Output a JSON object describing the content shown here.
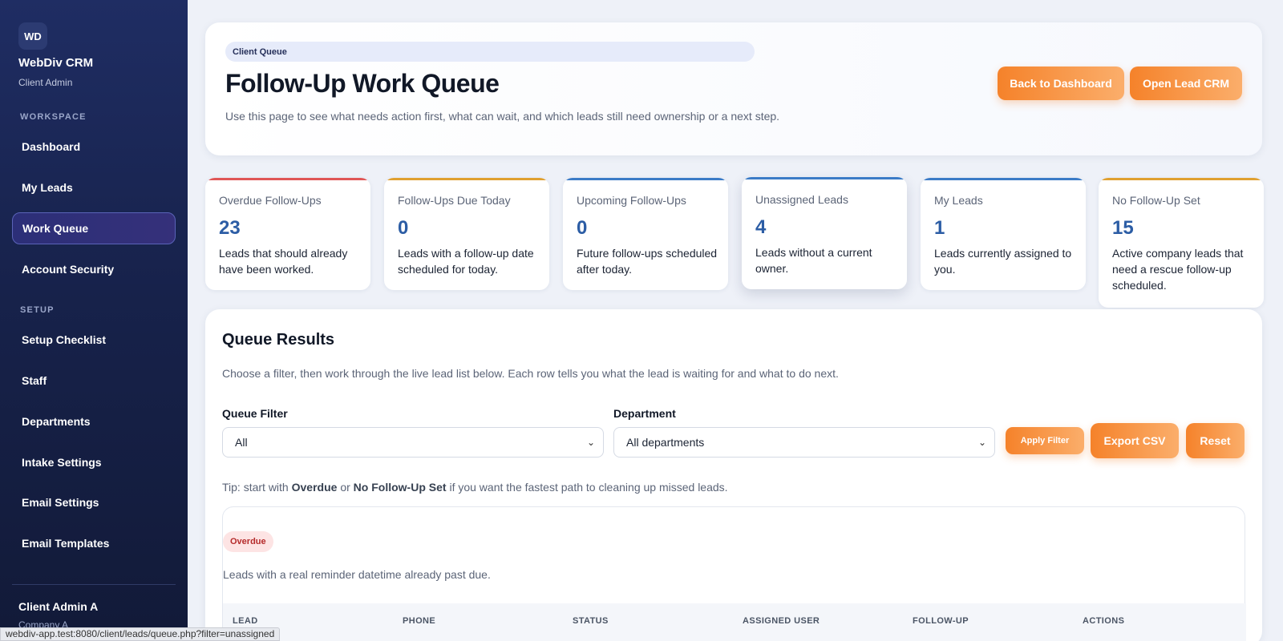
{
  "sidebar": {
    "badge": "WD",
    "brand": "WebDiv CRM",
    "role": "Client Admin",
    "sections": [
      "WORKSPACE",
      "SETUP"
    ],
    "workspace_items": [
      "Dashboard",
      "My Leads",
      "Work Queue",
      "Account Security"
    ],
    "setup_items": [
      "Setup Checklist",
      "Staff",
      "Departments",
      "Intake Settings",
      "Email Settings",
      "Email Templates"
    ],
    "user_name": "Client Admin A",
    "user_company": "Company A"
  },
  "status_url": "webdiv-app.test:8080/client/leads/queue.php?filter=unassigned",
  "hero": {
    "pill": "Client Queue",
    "title": "Follow-Up Work Queue",
    "description": "Use this page to see what needs action first, what can wait, and which leads still need ownership or a next step.",
    "back_button": "Back to Dashboard",
    "open_button": "Open Lead CRM"
  },
  "stats": [
    {
      "label": "Overdue Follow-Ups",
      "value": "23",
      "desc": "Leads that should already have been worked.",
      "color": "#e05656"
    },
    {
      "label": "Follow-Ups Due Today",
      "value": "0",
      "desc": "Leads with a follow-up date scheduled for today.",
      "color": "#e0a030"
    },
    {
      "label": "Upcoming Follow-Ups",
      "value": "0",
      "desc": "Future follow-ups scheduled after today.",
      "color": "#3b7bc7"
    },
    {
      "label": "Unassigned Leads",
      "value": "4",
      "desc": "Leads without a current owner.",
      "color": "#3b7bc7"
    },
    {
      "label": "My Leads",
      "value": "1",
      "desc": "Leads currently assigned to you.",
      "color": "#3b7bc7"
    },
    {
      "label": "No Follow-Up Set",
      "value": "15",
      "desc": "Active company leads that need a rescue follow-up scheduled.",
      "color": "#e0a030"
    }
  ],
  "results": {
    "title": "Queue Results",
    "description": "Choose a filter, then work through the live lead list below. Each row tells you what the lead is waiting for and what to do next.",
    "queue_filter_label": "Queue Filter",
    "queue_filter_value": "All",
    "department_label": "Department",
    "department_value": "All departments",
    "apply_button": "Apply Filter",
    "export_button": "Export CSV",
    "reset_button": "Reset",
    "tip_prefix": "Tip: start with ",
    "tip_overdue": "Overdue",
    "tip_or": " or ",
    "tip_no_followup": "No Follow-Up Set",
    "tip_suffix": " if you want the fastest path to cleaning up missed leads.",
    "group_label": "Overdue",
    "group_desc": "Leads with a real reminder datetime already past due.",
    "columns": [
      "LEAD",
      "PHONE",
      "STATUS",
      "ASSIGNED USER",
      "FOLLOW-UP",
      "ACTIONS"
    ]
  }
}
